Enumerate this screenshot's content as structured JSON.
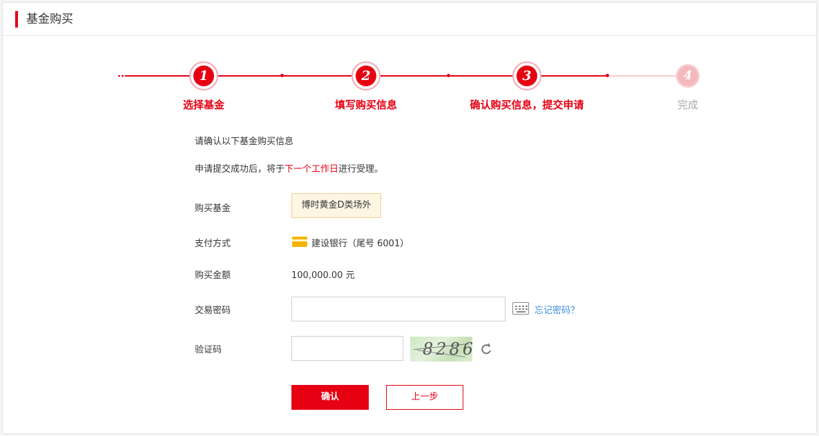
{
  "header": {
    "title": "基金购买"
  },
  "steps": [
    {
      "number": "1",
      "label": "选择基金",
      "state": "done"
    },
    {
      "number": "2",
      "label": "填写购买信息",
      "state": "done"
    },
    {
      "number": "3",
      "label": "确认购买信息，提交申请",
      "state": "current"
    },
    {
      "number": "4",
      "label": "完成",
      "state": "pending"
    }
  ],
  "intro": {
    "line1": "请确认以下基金购买信息",
    "line2_prefix": "申请提交成功后，将于",
    "line2_highlight": "下一个工作日",
    "line2_suffix": "进行受理。"
  },
  "form": {
    "fund_label": "购买基金",
    "fund_value": "博时黄金D类场外",
    "payment_label": "支付方式",
    "payment_value": "建设银行（尾号 6001）",
    "amount_label": "购买金额",
    "amount_value": "100,000.00 元",
    "password_label": "交易密码",
    "password_value": "",
    "forgot_password": "忘记密码？",
    "captcha_label": "验证码",
    "captcha_value": "",
    "captcha_text": "8286"
  },
  "buttons": {
    "confirm": "确认",
    "prev": "上一步"
  },
  "icons": {
    "card": "bank-card-icon",
    "keyboard": "keyboard-icon",
    "refresh": "refresh-icon"
  },
  "colors": {
    "accent": "#e60012",
    "link": "#3a8ee6",
    "inactive": "#f6c9cc"
  }
}
